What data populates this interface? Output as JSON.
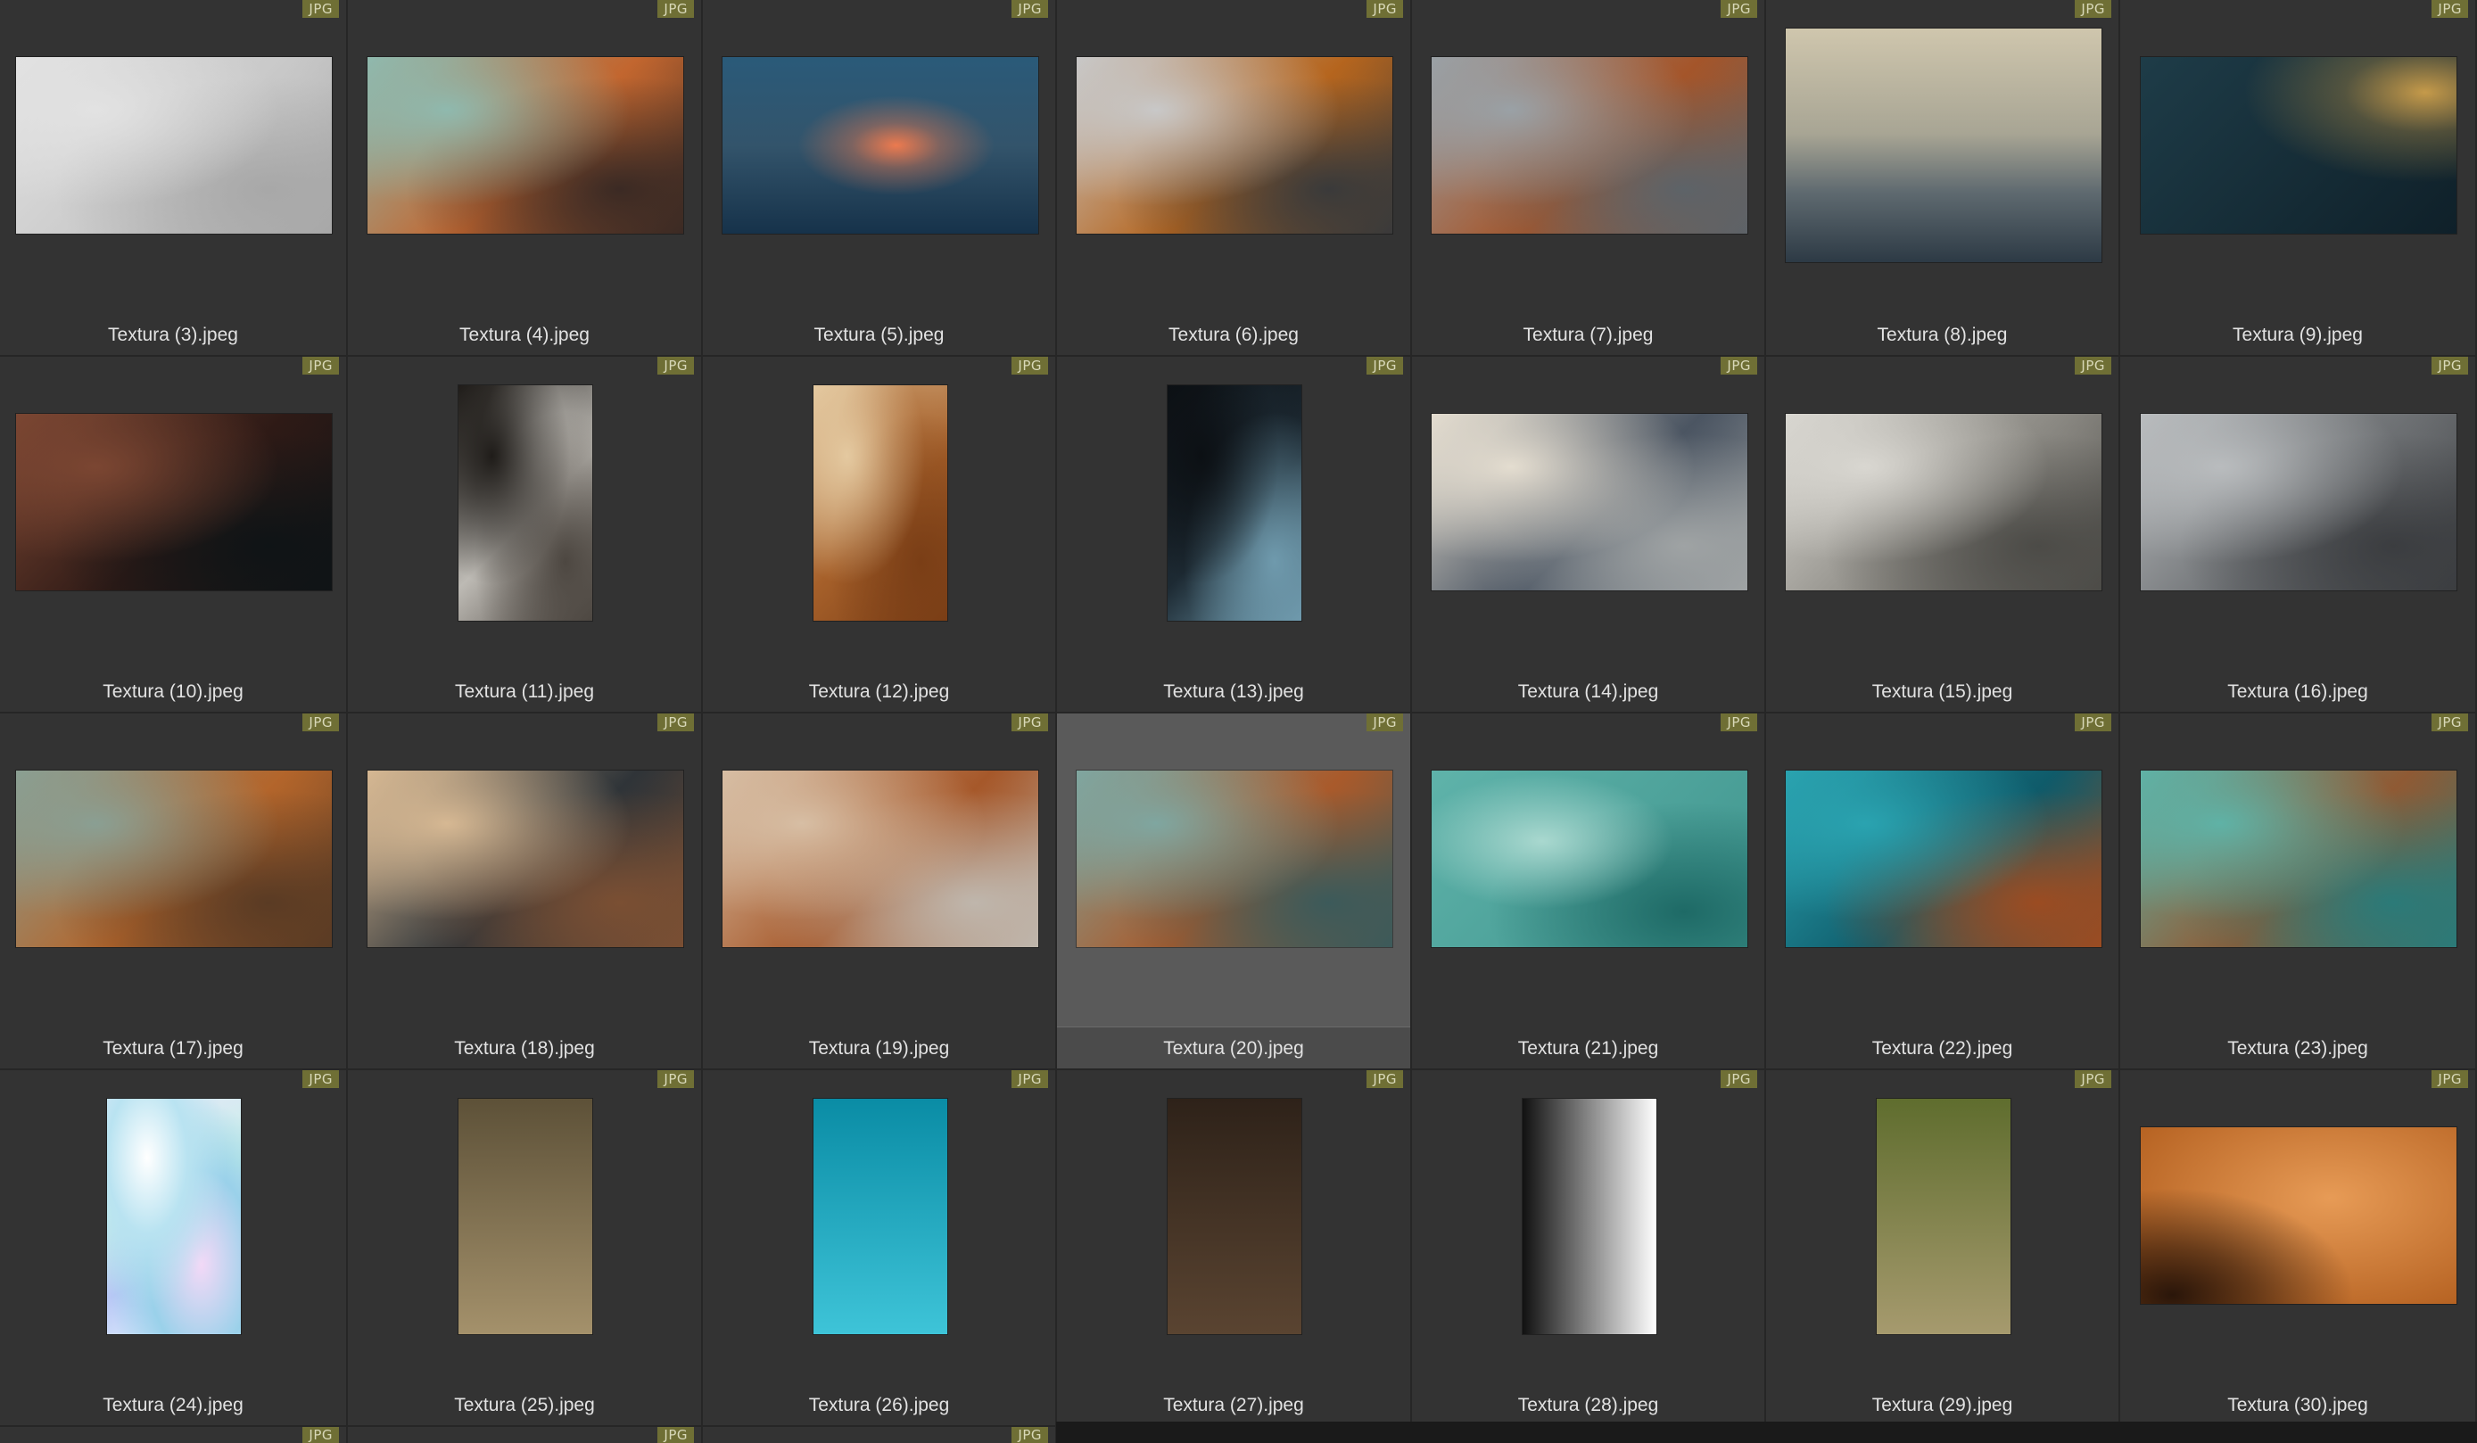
{
  "badge_label": "JPG",
  "selected_index": 17,
  "items": [
    {
      "name": "Textura (3).jpeg",
      "orient": "landscape",
      "texture": "concrete-grey",
      "colors": [
        "#e2e2e2",
        "#c9c9c9",
        "#a8a8a8"
      ]
    },
    {
      "name": "Textura (4).jpeg",
      "orient": "landscape",
      "texture": "teal-rust-streaks",
      "colors": [
        "#8fb9ae",
        "#c2662f",
        "#3b2a24"
      ]
    },
    {
      "name": "Textura (5).jpeg",
      "orient": "landscape",
      "texture": "blue-orange-glow",
      "colors": [
        "#2a5a79",
        "#ec7a4f",
        "#16324a"
      ]
    },
    {
      "name": "Textura (6).jpeg",
      "orient": "landscape",
      "texture": "rust-spots-grey",
      "colors": [
        "#c8c8c8",
        "#b5651e",
        "#3a3a3a"
      ]
    },
    {
      "name": "Textura (7).jpeg",
      "orient": "landscape",
      "texture": "grey-rust-metal",
      "colors": [
        "#9aa1a6",
        "#a4552a",
        "#5d6368"
      ]
    },
    {
      "name": "Textura (8).jpeg",
      "orient": "landscape-tall",
      "texture": "foggy-beige",
      "colors": [
        "#cfc6ad",
        "#5f6a70",
        "#2d3a45"
      ]
    },
    {
      "name": "Textura (9).jpeg",
      "orient": "landscape",
      "texture": "dark-teal-gold",
      "colors": [
        "#1e3c48",
        "#0f2029",
        "#c59a4a"
      ]
    },
    {
      "name": "Textura (10).jpeg",
      "orient": "landscape",
      "texture": "brown-dark-speckle",
      "colors": [
        "#7b4632",
        "#2e1a16",
        "#0f1416"
      ]
    },
    {
      "name": "Textura (11).jpeg",
      "orient": "portrait",
      "texture": "dark-grey-splash",
      "colors": [
        "#1f1c19",
        "#bdbab4",
        "#4d4741"
      ]
    },
    {
      "name": "Textura (12).jpeg",
      "orient": "portrait",
      "texture": "beige-brown-marble",
      "colors": [
        "#e4c9a0",
        "#a6602a",
        "#7a3e16"
      ]
    },
    {
      "name": "Textura (13).jpeg",
      "orient": "portrait",
      "texture": "black-blue-speckle",
      "colors": [
        "#0c1014",
        "#1d2a33",
        "#6f9aad"
      ]
    },
    {
      "name": "Textura (14).jpeg",
      "orient": "landscape",
      "texture": "beige-dark-wash",
      "colors": [
        "#e4ddd0",
        "#4b5562",
        "#9fa3a4"
      ]
    },
    {
      "name": "Textura (15).jpeg",
      "orient": "landscape",
      "texture": "grey-cracked-wall",
      "colors": [
        "#d9d7d1",
        "#8c8a84",
        "#4c4b47"
      ]
    },
    {
      "name": "Textura (16).jpeg",
      "orient": "landscape",
      "texture": "grey-concrete-dark",
      "colors": [
        "#b9bcbe",
        "#6d7073",
        "#3b3d40"
      ]
    },
    {
      "name": "Textura (17).jpeg",
      "orient": "landscape",
      "texture": "teal-rust-cracks",
      "colors": [
        "#8a9f93",
        "#b3652b",
        "#5a3b24"
      ]
    },
    {
      "name": "Textura (18).jpeg",
      "orient": "landscape",
      "texture": "beige-dark-peeling",
      "colors": [
        "#d6b893",
        "#2f3438",
        "#7a4f33"
      ]
    },
    {
      "name": "Textura (19).jpeg",
      "orient": "landscape",
      "texture": "beige-rust-frame",
      "colors": [
        "#d7bea4",
        "#a6582a",
        "#bfb6ac"
      ]
    },
    {
      "name": "Textura (20).jpeg",
      "orient": "landscape",
      "texture": "teal-rust-mix",
      "colors": [
        "#7fa6a0",
        "#a95a2b",
        "#3c5a5a"
      ]
    },
    {
      "name": "Textura (21).jpeg",
      "orient": "landscape",
      "texture": "teal-aqua",
      "colors": [
        "#5fb3aa",
        "#a9d8cf",
        "#1e6a66"
      ]
    },
    {
      "name": "Textura (22).jpeg",
      "orient": "landscape",
      "texture": "teal-rust-edge",
      "colors": [
        "#2aa3b0",
        "#0f5b6a",
        "#9b4c22"
      ]
    },
    {
      "name": "Textura (23).jpeg",
      "orient": "landscape",
      "texture": "teal-rust-cracked",
      "colors": [
        "#5fb2a6",
        "#8f5a34",
        "#2b7a78"
      ]
    },
    {
      "name": "Textura (24).jpeg",
      "orient": "portrait",
      "texture": "holographic",
      "colors": [
        "#b9e3f1",
        "#e8e6fb",
        "#9ad1ea"
      ]
    },
    {
      "name": "Textura (25).jpeg",
      "orient": "portrait",
      "texture": "gradient-khaki",
      "colors": [
        "#5d5138",
        "#a4916b"
      ]
    },
    {
      "name": "Textura (26).jpeg",
      "orient": "portrait",
      "texture": "gradient-cyan",
      "colors": [
        "#0a8ca5",
        "#3ec4d8"
      ]
    },
    {
      "name": "Textura (27).jpeg",
      "orient": "portrait",
      "texture": "gradient-brown",
      "colors": [
        "#2e2219",
        "#5a4431"
      ]
    },
    {
      "name": "Textura (28).jpeg",
      "orient": "portrait",
      "texture": "gradient-black-white",
      "colors": [
        "#111111",
        "#ffffff"
      ]
    },
    {
      "name": "Textura (29).jpeg",
      "orient": "portrait",
      "texture": "gradient-olive",
      "colors": [
        "#5f6d2e",
        "#a69a6e"
      ]
    },
    {
      "name": "Textura (30).jpeg",
      "orient": "landscape",
      "texture": "orange-grunge",
      "colors": [
        "#e79b56",
        "#b35f1f",
        "#2a160a"
      ]
    }
  ],
  "partial_row_badges": 3
}
